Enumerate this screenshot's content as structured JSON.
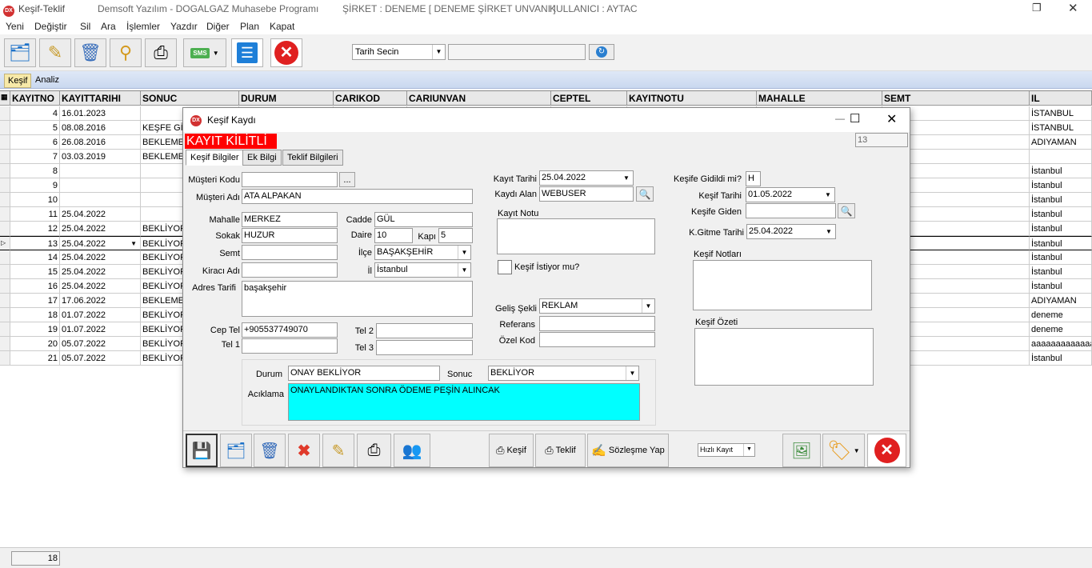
{
  "window": {
    "app_icon": "DX",
    "title": "Keşif-Teklif",
    "company_app": "Demsoft Yazılım - DOGALGAZ Muhasebe Programı",
    "sirket": "ŞİRKET : DENEME [ DENEME ŞİRKET UNVANI ]",
    "kullanici": "KULLANICI : AYTAC"
  },
  "menu": [
    "Yeni",
    "Değiştir",
    "Sil",
    "Ara",
    "İşlemler",
    "Yazdır",
    "Diğer",
    "Plan",
    "Kapat"
  ],
  "toolbar": {
    "date_filter": "Tarih Secin",
    "date_value": "",
    "sms_label": "SMS"
  },
  "tabs": [
    "Keşif",
    "Analiz"
  ],
  "grid": {
    "columns": [
      "KAYITNO",
      "KAYITTARIHI",
      "SONUC",
      "DURUM",
      "CARIKOD",
      "CARIUNVAN",
      "CEPTEL",
      "KAYITNOTU",
      "MAHALLE",
      "SEMT",
      "IL"
    ],
    "rows": [
      {
        "no": "4",
        "date": "16.01.2023",
        "sonuc": "",
        "il": "İSTANBUL"
      },
      {
        "no": "5",
        "date": "08.08.2016",
        "sonuc": "KEŞFE GİD",
        "il": "İSTANBUL"
      },
      {
        "no": "6",
        "date": "26.08.2016",
        "sonuc": "BEKLEMED",
        "il": "ADIYAMAN"
      },
      {
        "no": "7",
        "date": "03.03.2019",
        "sonuc": "BEKLEMED",
        "il": ""
      },
      {
        "no": "8",
        "date": "",
        "sonuc": "",
        "il": "İstanbul"
      },
      {
        "no": "9",
        "date": "",
        "sonuc": "",
        "il": "İstanbul"
      },
      {
        "no": "10",
        "date": "",
        "sonuc": "",
        "il": "İstanbul"
      },
      {
        "no": "11",
        "date": "25.04.2022",
        "sonuc": "",
        "il": "İstanbul"
      },
      {
        "no": "12",
        "date": "25.04.2022",
        "sonuc": "BEKLİYOR",
        "il": "İstanbul"
      },
      {
        "no": "13",
        "date": "25.04.2022",
        "sonuc": "BEKLİYOR",
        "il": "İstanbul"
      },
      {
        "no": "14",
        "date": "25.04.2022",
        "sonuc": "BEKLİYOR",
        "il": "İstanbul"
      },
      {
        "no": "15",
        "date": "25.04.2022",
        "sonuc": "BEKLİYOR",
        "il": "İstanbul"
      },
      {
        "no": "16",
        "date": "25.04.2022",
        "sonuc": "BEKLİYOR",
        "il": "İstanbul"
      },
      {
        "no": "17",
        "date": "17.06.2022",
        "sonuc": "BEKLEMED",
        "il": "ADIYAMAN"
      },
      {
        "no": "18",
        "date": "01.07.2022",
        "sonuc": "BEKLİYOR",
        "il": "deneme"
      },
      {
        "no": "19",
        "date": "01.07.2022",
        "sonuc": "BEKLİYOR",
        "il": "deneme"
      },
      {
        "no": "20",
        "date": "05.07.2022",
        "sonuc": "BEKLİYOR",
        "il": "aaaaaaaaaaaaa"
      },
      {
        "no": "21",
        "date": "05.07.2022",
        "sonuc": "BEKLİYOR",
        "il": "İstanbul"
      }
    ],
    "selected_row": "13"
  },
  "status": {
    "count": "18"
  },
  "dialog": {
    "title": "Keşif Kaydı",
    "locked_banner": "KAYIT KİLİTLİ",
    "record_no": "13",
    "tabs": [
      "Keşif Bilgiler",
      "Ek Bilgi",
      "Teklif Bilgileri"
    ],
    "labels": {
      "musteri_kodu": "Müşteri Kodu",
      "musteri_adi": "Müşteri Adı",
      "mahalle": "Mahalle",
      "cadde": "Cadde",
      "sokak": "Sokak",
      "daire": "Daire",
      "kapi": "Kapı",
      "semt": "Semt",
      "ilce": "İlçe",
      "kiraci_adi": "Kiracı Adı",
      "il": "İl",
      "adres": "Adres Tarifi",
      "cep_tel": "Cep Tel",
      "tel1": "Tel 1",
      "tel2": "Tel 2",
      "tel3": "Tel 3",
      "durum": "Durum",
      "sonuc": "Sonuc",
      "aciklama": "Acıklama",
      "kayit_tarihi": "Kayıt Tarihi",
      "kaydi_alan": "Kaydı Alan",
      "kayit_notu": "Kayıt Notu",
      "kesif_istiyor": "Keşif İstiyor mu?",
      "gelis_sekli": "Geliş Şekli",
      "referans": "Referans",
      "ozel_kod": "Özel Kod",
      "kesife_gidildi": "Keşife Gidildi mi?",
      "kesif_tarihi": "Keşif Tarihi",
      "kesife_giden": "Keşife Giden",
      "k_gitme_tarihi": "K.Gitme Tarihi",
      "kesif_notlari": "Keşif Notları",
      "kesif_ozeti": "Keşif Özeti"
    },
    "values": {
      "musteri_kodu": "",
      "musteri_adi": "ATA ALPAKAN",
      "mahalle": "MERKEZ",
      "cadde": "GÜL",
      "sokak": "HUZUR",
      "daire": "10",
      "kapi": "5",
      "semt": "",
      "ilce": "BAŞAKŞEHİR",
      "kiraci_adi": "",
      "il": "İstanbul",
      "adres": "başakşehir",
      "cep_tel": "+905537749070",
      "tel1": "",
      "tel2": "",
      "tel3": "",
      "durum": "ONAY BEKLİYOR",
      "sonuc": "BEKLİYOR",
      "aciklama": "ONAYLANDIKTAN SONRA ÖDEME PEŞİN ALINCAK",
      "kayit_tarihi": "25.04.2022",
      "kaydi_alan": "WEBUSER",
      "kayit_notu": "",
      "kesif_istiyor": false,
      "gelis_sekli": "REKLAM",
      "referans": "",
      "ozel_kod": "",
      "kesife_gidildi": "H",
      "kesif_tarihi": "01.05.2022",
      "kesife_giden": "",
      "k_gitme_tarihi": "25.04.2022",
      "kesif_notlari": "",
      "kesif_ozeti": ""
    },
    "buttons": {
      "ellipsis": "...",
      "kesif": "Keşif",
      "teklif": "Teklif",
      "sozlesme": "Sözleşme Yap",
      "hizli_kayit": "Hızlı Kayıt"
    }
  },
  "colors": {
    "locked_bg": "#ff0000",
    "aciklama_bg": "#00ffff",
    "tab_active": "#f7e9a8"
  }
}
